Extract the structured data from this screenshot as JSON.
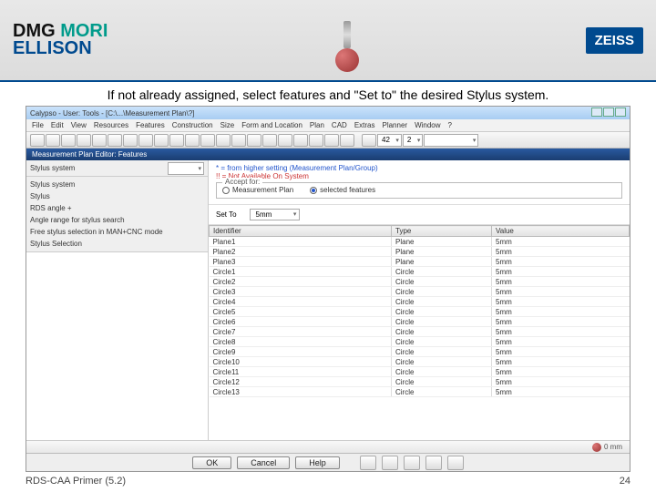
{
  "branding": {
    "line1a": "DMG ",
    "line1b": "MORI",
    "line2": "ELLISON",
    "right": "ZEISS"
  },
  "caption": "If not already assigned, select features and \"Set to\" the desired Stylus system.",
  "window": {
    "title": "Calypso - User: Tools - [C:\\...\\Measurement Plan\\?]"
  },
  "menu": [
    "File",
    "Edit",
    "View",
    "Resources",
    "Features",
    "Construction",
    "Size",
    "Form and Location",
    "Plan",
    "CAD",
    "Extras",
    "Planner",
    "Window",
    "?"
  ],
  "toolbar": {
    "combo1": "42",
    "combo2": "2"
  },
  "panel": {
    "title": "Measurement Plan Editor: Features"
  },
  "props": {
    "system_label": "Stylus system",
    "rows": [
      "Stylus system",
      "Stylus",
      "RDS angle +",
      "Angle range for stylus search",
      "Free stylus selection in MAN+CNC mode",
      "Stylus Selection"
    ]
  },
  "hints": {
    "blue": "* = from higher setting (Measurement Plan/Group)",
    "red": "!! = Not Available On System",
    "accept_legend": "Accept for:",
    "radio_plan": "Measurement Plan",
    "radio_sel": "selected features"
  },
  "setto": {
    "label": "Set To",
    "value": "5mm"
  },
  "columns": [
    "Identifier",
    "Type",
    "Value"
  ],
  "rows": [
    {
      "id": "Plane1",
      "type": "Plane",
      "val": "5mm"
    },
    {
      "id": "Plane2",
      "type": "Plane",
      "val": "5mm"
    },
    {
      "id": "Plane3",
      "type": "Plane",
      "val": "5mm"
    },
    {
      "id": "Circle1",
      "type": "Circle",
      "val": "5mm"
    },
    {
      "id": "Circle2",
      "type": "Circle",
      "val": "5mm"
    },
    {
      "id": "Circle3",
      "type": "Circle",
      "val": "5mm"
    },
    {
      "id": "Circle4",
      "type": "Circle",
      "val": "5mm"
    },
    {
      "id": "Circle5",
      "type": "Circle",
      "val": "5mm"
    },
    {
      "id": "Circle6",
      "type": "Circle",
      "val": "5mm"
    },
    {
      "id": "Circle7",
      "type": "Circle",
      "val": "5mm"
    },
    {
      "id": "Circle8",
      "type": "Circle",
      "val": "5mm"
    },
    {
      "id": "Circle9",
      "type": "Circle",
      "val": "5mm"
    },
    {
      "id": "Circle10",
      "type": "Circle",
      "val": "5mm"
    },
    {
      "id": "Circle11",
      "type": "Circle",
      "val": "5mm"
    },
    {
      "id": "Circle12",
      "type": "Circle",
      "val": "5mm"
    },
    {
      "id": "Circle13",
      "type": "Circle",
      "val": "5mm"
    }
  ],
  "status": {
    "right": "0 mm"
  },
  "dialog": {
    "ok": "OK",
    "cancel": "Cancel",
    "help": "Help"
  },
  "footer": {
    "left": "RDS-CAA Primer (5.2)",
    "right": "24"
  }
}
